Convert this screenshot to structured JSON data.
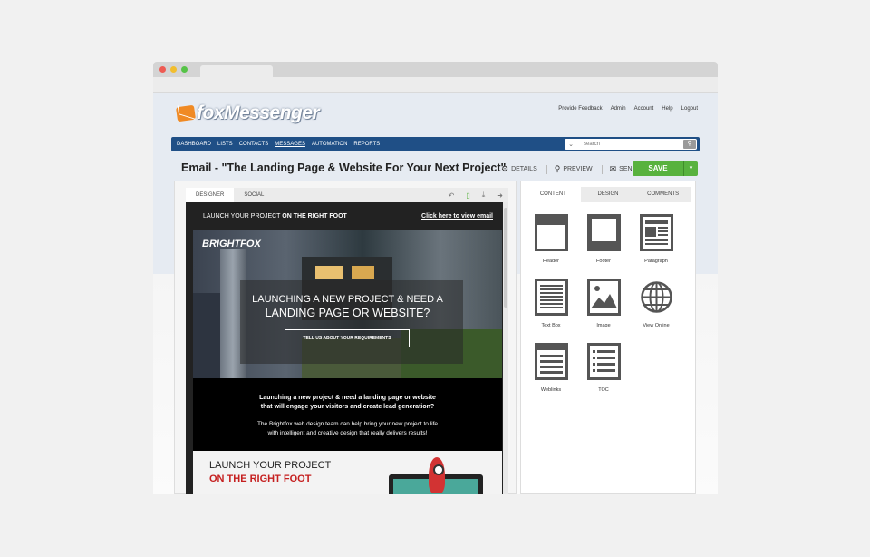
{
  "app": {
    "name": "foxMessenger",
    "top_links": [
      "Provide Feedback",
      "Admin",
      "Account",
      "Help",
      "Logout"
    ]
  },
  "nav": {
    "items": [
      {
        "label": "DASHBOARD",
        "active": false
      },
      {
        "label": "LISTS",
        "active": false
      },
      {
        "label": "CONTACTS",
        "active": false
      },
      {
        "label": "MESSAGES",
        "active": true
      },
      {
        "label": "AUTOMATION",
        "active": false
      },
      {
        "label": "REPORTS",
        "active": false
      }
    ],
    "search_placeholder": "search"
  },
  "message": {
    "title": "Email - \"The Landing Page & Website For Your Next Project\"",
    "details_label": "DETAILS",
    "preview_label": "PREVIEW",
    "send_label": "SEND",
    "save_label": "SAVE"
  },
  "editor": {
    "tabs": [
      {
        "label": "DESIGNER",
        "active": true
      },
      {
        "label": "SOCIAL",
        "active": false
      }
    ]
  },
  "email": {
    "preheader_plain": "LAUNCH YOUR PROJECT ",
    "preheader_bold": "ON THE RIGHT FOOT",
    "view_link": "Click here to view email",
    "brand": "BRIGHTFOX",
    "hero_line1": "LAUNCHING A NEW PROJECT & NEED A",
    "hero_line2": "LANDING PAGE OR WEBSITE?",
    "hero_button": "TELL US ABOUT YOUR REQUIREMENTS",
    "body_bold_1": "Launching a new project & need a landing page or website",
    "body_bold_2": "that will engage your visitors and create lead generation?",
    "body_1": "The Brightfox web design team can help bring your new project to life",
    "body_2": "with intelligent and creative design that really delivers results!",
    "lower_title_1": "LAUNCH YOUR PROJECT",
    "lower_title_2": "ON THE RIGHT FOOT"
  },
  "panel": {
    "tabs": [
      {
        "label": "CONTENT",
        "active": true
      },
      {
        "label": "DESIGN",
        "active": false
      },
      {
        "label": "COMMENTS",
        "active": false
      }
    ],
    "blocks": [
      {
        "label": "Header",
        "icon": "header-block-icon"
      },
      {
        "label": "Footer",
        "icon": "footer-block-icon"
      },
      {
        "label": "Paragraph",
        "icon": "paragraph-block-icon"
      },
      {
        "label": "Text Box",
        "icon": "text-box-icon"
      },
      {
        "label": "Image",
        "icon": "image-block-icon"
      },
      {
        "label": "View Online",
        "icon": "globe-icon"
      },
      {
        "label": "Weblinks",
        "icon": "weblinks-icon"
      },
      {
        "label": "TOC",
        "icon": "toc-icon"
      }
    ]
  },
  "colors": {
    "nav_bg": "#1f4f86",
    "save_green": "#58b23e",
    "accent_orange": "#f08a24",
    "accent_red": "#c51f1f"
  }
}
